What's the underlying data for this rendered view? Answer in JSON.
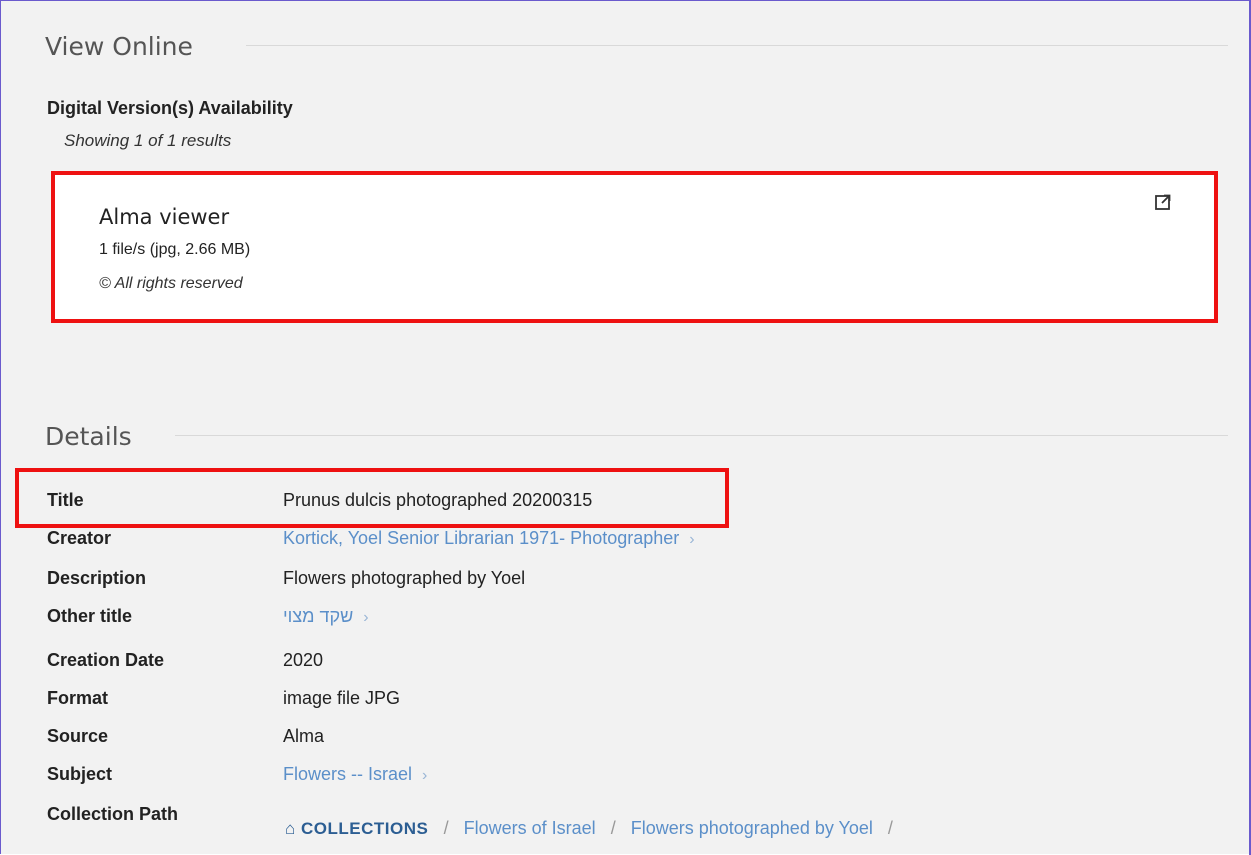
{
  "view_online": {
    "heading": "View Online",
    "availability_label": "Digital Version(s) Availability",
    "showing": "Showing 1 of 1 results",
    "viewer": {
      "name": "Alma viewer",
      "files": "1 file/s (jpg, 2.66 MB)",
      "rights": "© All rights reserved",
      "icon": "external-link-icon"
    }
  },
  "details": {
    "heading": "Details",
    "title_label": "Title",
    "title_value": "Prunus dulcis photographed 20200315",
    "creator_label": "Creator",
    "creator_value": "Kortick, Yoel Senior Librarian 1971- Photographer",
    "description_label": "Description",
    "description_value": "Flowers photographed by Yoel",
    "other_title_label": "Other title",
    "other_title_value": "שקד מצוי",
    "creation_date_label": "Creation Date",
    "creation_date_value": "2020",
    "format_label": "Format",
    "format_value": "image file JPG",
    "source_label": "Source",
    "source_value": "Alma",
    "subject_label": "Subject",
    "subject_value": "Flowers -- Israel",
    "collection_path_label": "Collection Path",
    "collection_path": {
      "home": "COLLECTIONS",
      "items": [
        "Flowers of Israel",
        "Flowers photographed by Yoel"
      ]
    }
  },
  "colors": {
    "highlight": "#ee1111",
    "link": "#5b8fc9",
    "frame": "#6a5acd"
  }
}
